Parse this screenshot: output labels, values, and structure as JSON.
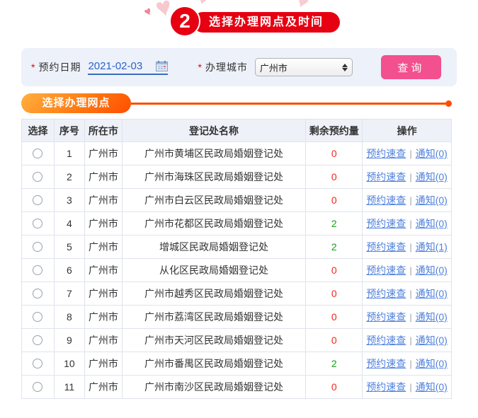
{
  "step_banner": {
    "number": "2",
    "title": "选择办理网点及时间"
  },
  "form": {
    "required_marker": "*",
    "date_label": "预约日期",
    "date_value": "2021-02-03",
    "city_label": "办理城市",
    "city_value": "广州市",
    "query_button": "查询"
  },
  "section": {
    "title": "选择办理网点"
  },
  "table": {
    "headers": [
      "选择",
      "序号",
      "所在市",
      "登记处名称",
      "剩余预约量",
      "操作"
    ],
    "link_labels": {
      "quick_check": "预约速查",
      "separator": "|"
    },
    "rows": [
      {
        "no": "1",
        "city": "广州市",
        "name": "广州市黄埔区民政局婚姻登记处",
        "remaining": "0",
        "notice": "通知(0)"
      },
      {
        "no": "2",
        "city": "广州市",
        "name": "广州市海珠区民政局婚姻登记处",
        "remaining": "0",
        "notice": "通知(0)"
      },
      {
        "no": "3",
        "city": "广州市",
        "name": "广州市白云区民政局婚姻登记处",
        "remaining": "0",
        "notice": "通知(0)"
      },
      {
        "no": "4",
        "city": "广州市",
        "name": "广州市花都区民政局婚姻登记处",
        "remaining": "2",
        "notice": "通知(0)"
      },
      {
        "no": "5",
        "city": "广州市",
        "name": "增城区民政局婚姻登记处",
        "remaining": "2",
        "notice": "通知(1)"
      },
      {
        "no": "6",
        "city": "广州市",
        "name": "从化区民政局婚姻登记处",
        "remaining": "0",
        "notice": "通知(0)"
      },
      {
        "no": "7",
        "city": "广州市",
        "name": "广州市越秀区民政局婚姻登记处",
        "remaining": "0",
        "notice": "通知(0)"
      },
      {
        "no": "8",
        "city": "广州市",
        "name": "广州市荔湾区民政局婚姻登记处",
        "remaining": "0",
        "notice": "通知(0)"
      },
      {
        "no": "9",
        "city": "广州市",
        "name": "广州市天河区民政局婚姻登记处",
        "remaining": "0",
        "notice": "通知(0)"
      },
      {
        "no": "10",
        "city": "广州市",
        "name": "广州市番禺区民政局婚姻登记处",
        "remaining": "2",
        "notice": "通知(0)"
      },
      {
        "no": "11",
        "city": "广州市",
        "name": "广州市南沙区民政局婚姻登记处",
        "remaining": "0",
        "notice": "通知(0)"
      }
    ]
  },
  "colors": {
    "brand_red": "#e60012",
    "accent_orange": "#ff4d00",
    "button_pink": "#f2508e",
    "link_blue": "#4f81dd",
    "count_zero_red": "#f5261a",
    "count_available_green": "#12a312"
  }
}
